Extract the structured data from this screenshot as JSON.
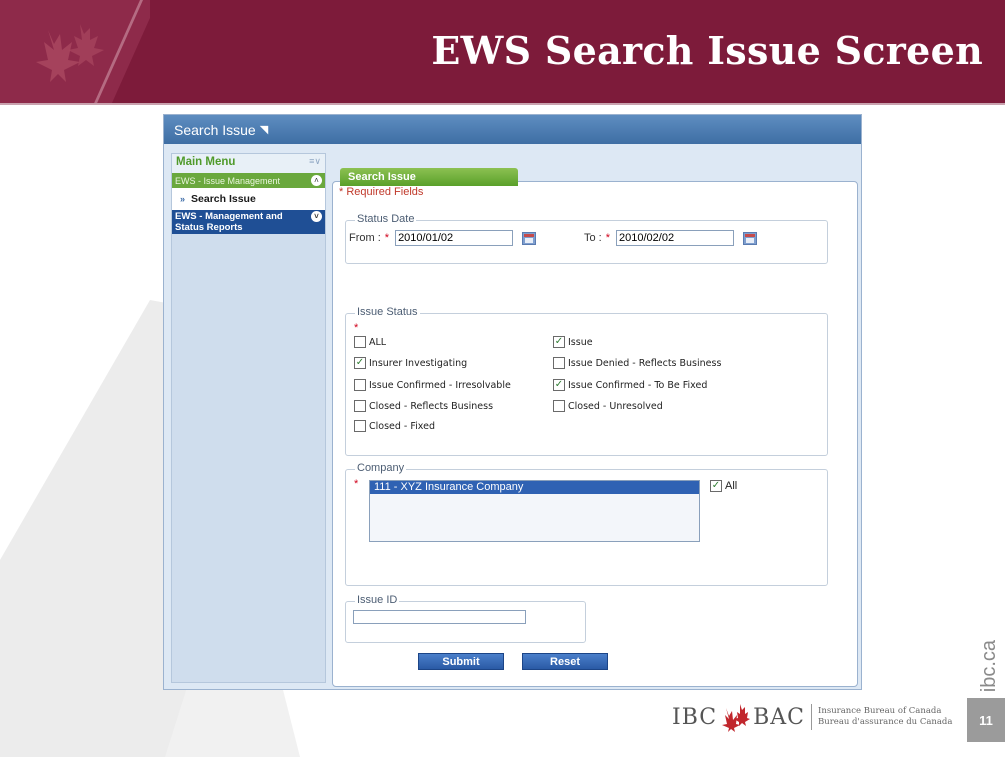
{
  "slide": {
    "title": "EWS Search Issue Screen",
    "side_url": "ibc.ca",
    "page_number": "11",
    "logo": {
      "left": "IBC",
      "right": "BAC",
      "text_en": "Insurance Bureau of Canada",
      "text_fr": "Bureau d'assurance du Canada"
    },
    "colors": {
      "header": "#7d1b3a",
      "accent_green": "#6aa83d",
      "accent_blue": "#2f62b3"
    }
  },
  "app": {
    "title": "Search Issue",
    "pin_icon": "pin-icon"
  },
  "sidebar": {
    "menu_title": "Main Menu",
    "category_1": "EWS - Issue Management",
    "item_1": "Search Issue",
    "category_2_line1": "EWS - Management and",
    "category_2_line2": "Status Reports"
  },
  "form": {
    "tab_label": "Search Issue",
    "required_note": "* Required Fields",
    "status_date": {
      "legend": "Status Date",
      "from_label": "From :",
      "from_value": "2010/01/02",
      "to_label": "To :",
      "to_value": "2010/02/02"
    },
    "issue_status": {
      "legend": "Issue Status",
      "options": [
        {
          "label": "ALL",
          "checked": false
        },
        {
          "label": "Issue",
          "checked": true
        },
        {
          "label": "Insurer Investigating",
          "checked": true
        },
        {
          "label": "Issue Denied - Reflects Business",
          "checked": false
        },
        {
          "label": "Issue Confirmed - Irresolvable",
          "checked": false
        },
        {
          "label": "Issue Confirmed - To Be Fixed",
          "checked": true
        },
        {
          "label": "Closed - Reflects Business",
          "checked": false
        },
        {
          "label": "Closed - Unresolved",
          "checked": false
        },
        {
          "label": "Closed - Fixed",
          "checked": false
        }
      ]
    },
    "company": {
      "legend": "Company",
      "selected": "111 - XYZ Insurance Company",
      "all_label": "All",
      "all_checked": true
    },
    "issue_id": {
      "legend": "Issue ID",
      "value": ""
    },
    "buttons": {
      "submit": "Submit",
      "reset": "Reset"
    }
  }
}
